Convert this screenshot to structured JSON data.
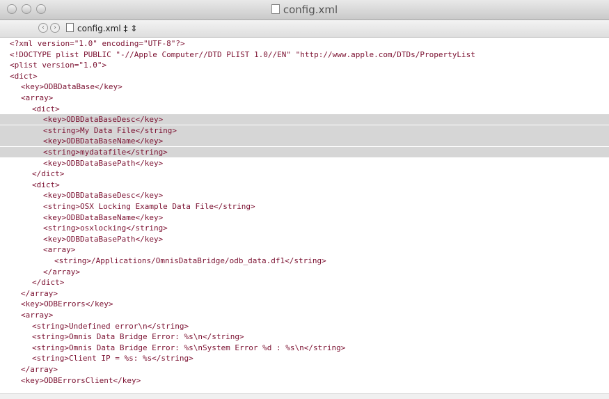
{
  "window": {
    "title": "config.xml"
  },
  "navbar": {
    "file": "config.xml ‡ ⇕"
  },
  "lines": [
    {
      "text": "<?xml version=\"1.0\" encoding=\"UTF-8\"?>",
      "indent": 0,
      "hl": false
    },
    {
      "text": "<!DOCTYPE plist PUBLIC \"-//Apple Computer//DTD PLIST 1.0//EN\" \"http://www.apple.com/DTDs/PropertyList",
      "indent": 0,
      "hl": false
    },
    {
      "text": "<plist version=\"1.0\">",
      "indent": 0,
      "hl": false
    },
    {
      "text": "<dict>",
      "indent": 0,
      "hl": false
    },
    {
      "text": "<key>ODBDataBase</key>",
      "indent": 1,
      "hl": false
    },
    {
      "text": "<array>",
      "indent": 1,
      "hl": false
    },
    {
      "text": "<dict>",
      "indent": 2,
      "hl": false
    },
    {
      "text": "<key>ODBDataBaseDesc</key>",
      "indent": 3,
      "hl": true
    },
    {
      "text": "<string>My Data File</string>",
      "indent": 3,
      "hl": true
    },
    {
      "text": "<key>ODBDataBaseName</key>",
      "indent": 3,
      "hl": true
    },
    {
      "text": "<string>mydatafile</string>",
      "indent": 3,
      "hl": true
    },
    {
      "text": "<key>ODBDataBasePath</key>",
      "indent": 3,
      "hl": false
    },
    {
      "text": "</dict>",
      "indent": 2,
      "hl": false
    },
    {
      "text": "<dict>",
      "indent": 2,
      "hl": false
    },
    {
      "text": "<key>ODBDataBaseDesc</key>",
      "indent": 3,
      "hl": false
    },
    {
      "text": "<string>OSX Locking Example Data File</string>",
      "indent": 3,
      "hl": false
    },
    {
      "text": "<key>ODBDataBaseName</key>",
      "indent": 3,
      "hl": false
    },
    {
      "text": "<string>osxlocking</string>",
      "indent": 3,
      "hl": false
    },
    {
      "text": "<key>ODBDataBasePath</key>",
      "indent": 3,
      "hl": false
    },
    {
      "text": "<array>",
      "indent": 3,
      "hl": false
    },
    {
      "text": "<string>/Applications/OmnisDataBridge/odb_data.df1</string>",
      "indent": 4,
      "hl": false
    },
    {
      "text": "</array>",
      "indent": 3,
      "hl": false
    },
    {
      "text": "</dict>",
      "indent": 2,
      "hl": false
    },
    {
      "text": "</array>",
      "indent": 1,
      "hl": false
    },
    {
      "text": "<key>ODBErrors</key>",
      "indent": 1,
      "hl": false
    },
    {
      "text": "<array>",
      "indent": 1,
      "hl": false
    },
    {
      "text": "<string>Undefined error\\n</string>",
      "indent": 2,
      "hl": false
    },
    {
      "text": "<string>Omnis Data Bridge Error: %s\\n</string>",
      "indent": 2,
      "hl": false
    },
    {
      "text": "<string>Omnis Data Bridge Error: %s\\nSystem Error %d : %s\\n</string>",
      "indent": 2,
      "hl": false
    },
    {
      "text": "<string>Client IP = %s: %s</string>",
      "indent": 2,
      "hl": false
    },
    {
      "text": "</array>",
      "indent": 1,
      "hl": false
    },
    {
      "text": "<key>ODBErrorsClient</key>",
      "indent": 1,
      "hl": false
    }
  ]
}
